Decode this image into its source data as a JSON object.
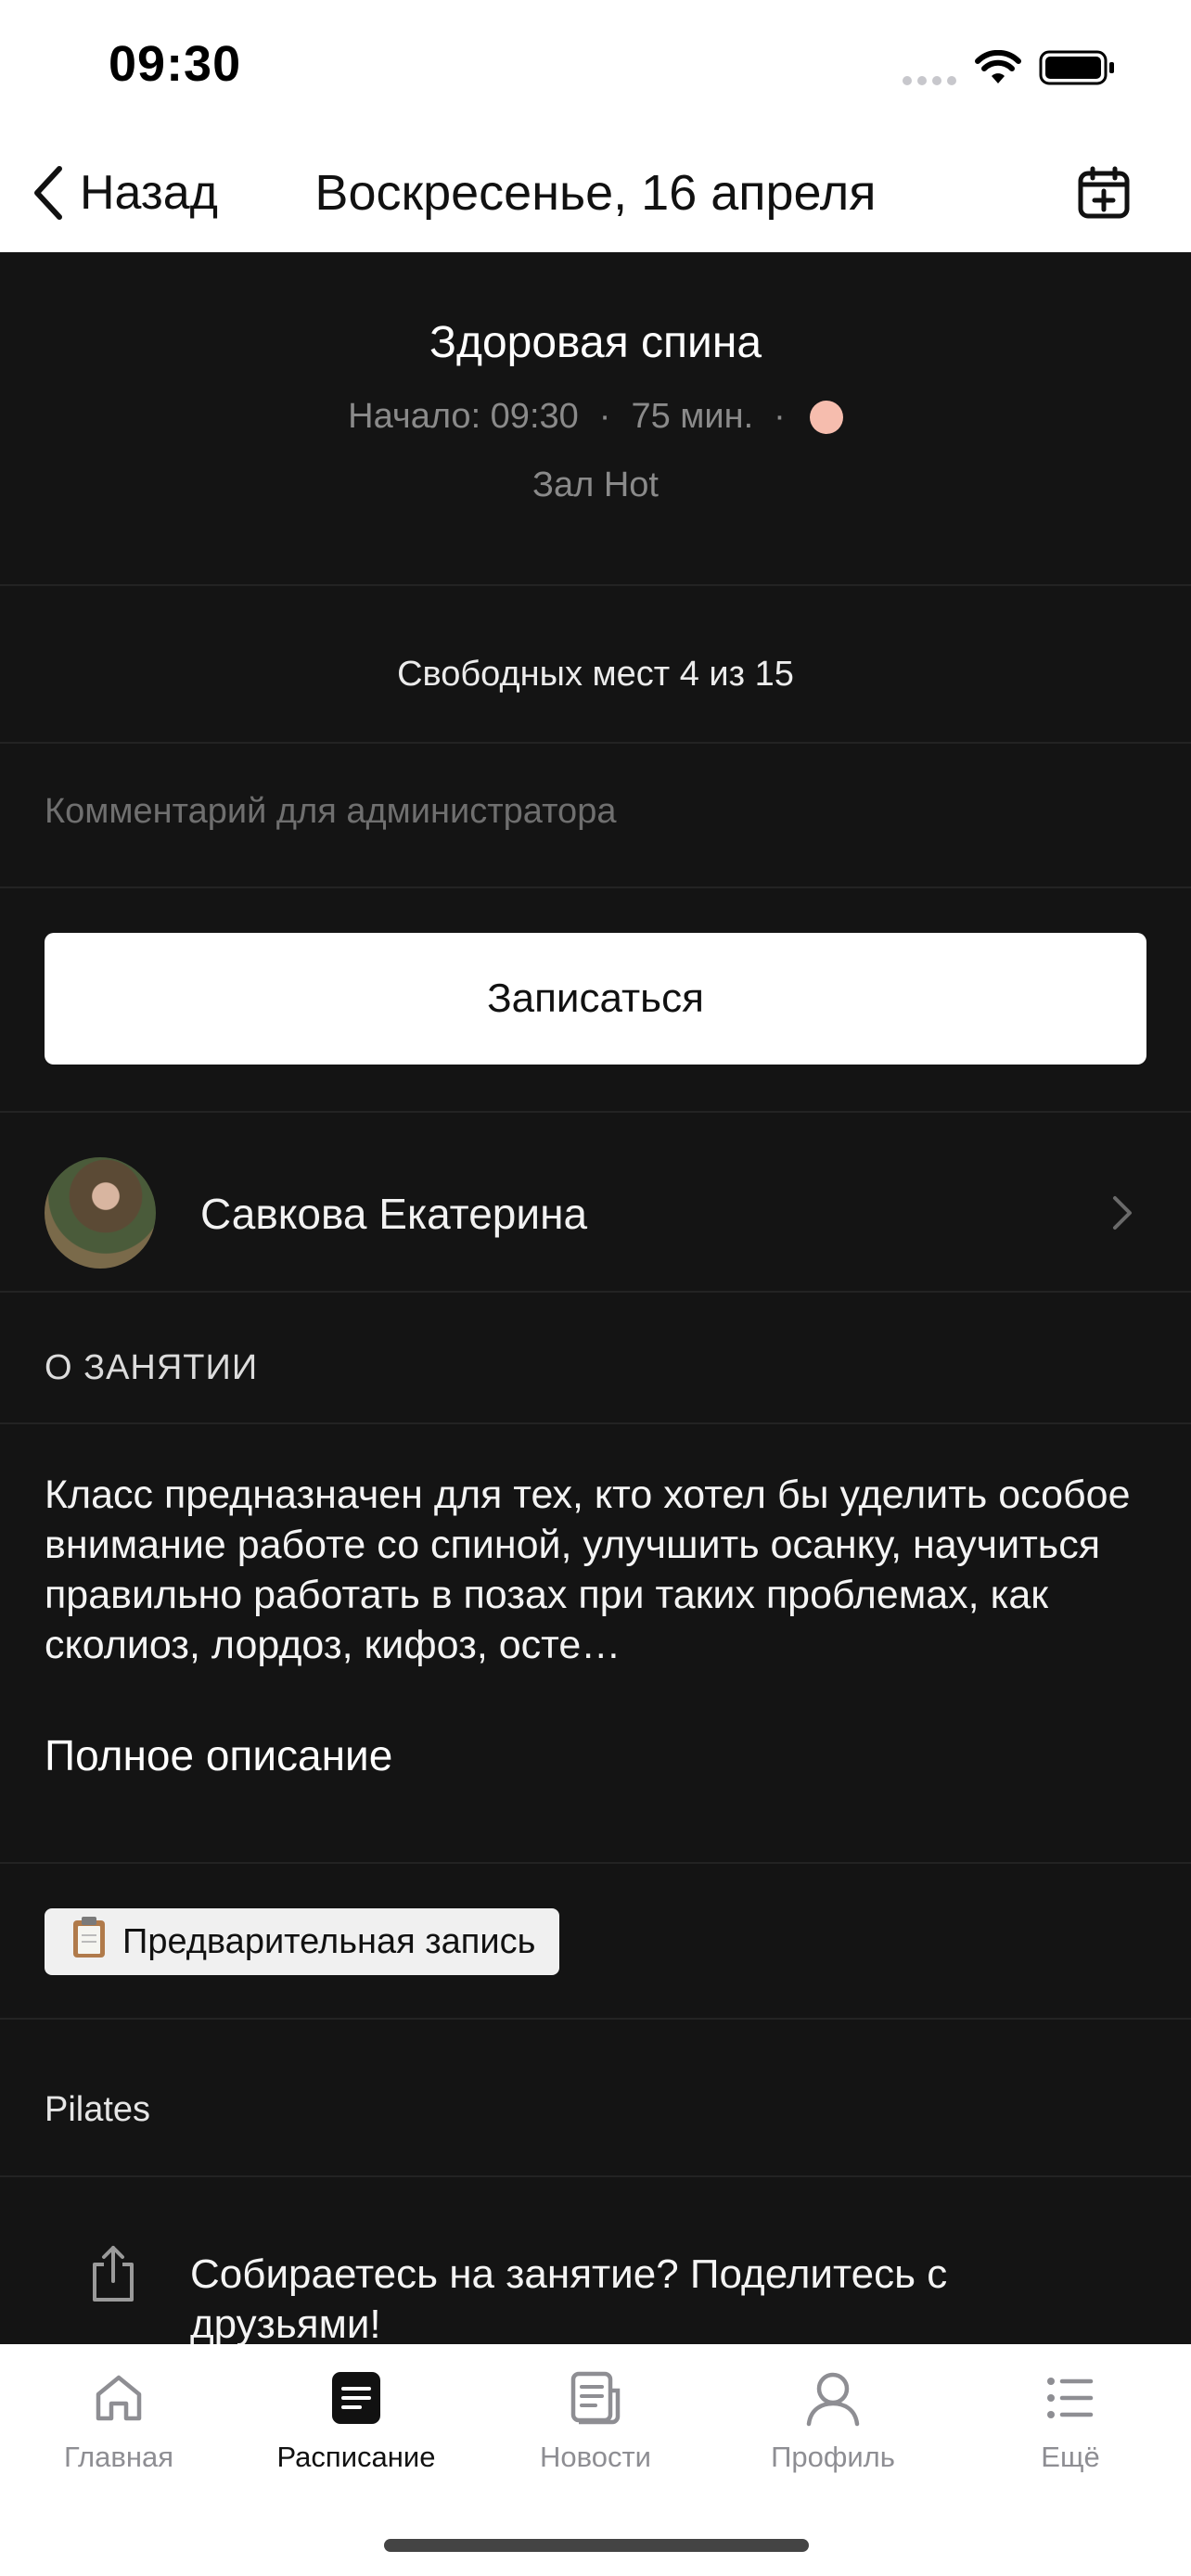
{
  "status_bar": {
    "time": "09:30"
  },
  "nav": {
    "back_label": "Назад",
    "title": "Воскресенье, 16 апреля"
  },
  "class": {
    "title": "Здоровая спина",
    "start": "Начало: 09:30",
    "duration": "75 мин.",
    "hall": "Зал Hot",
    "indicator_color": "#f6bdae"
  },
  "seats": "Свободных мест 4 из 15",
  "comment": {
    "placeholder": "Комментарий для администратора",
    "value": ""
  },
  "signup_label": "Записаться",
  "trainer": {
    "name": "Савкова Екатерина"
  },
  "about": {
    "heading": "О ЗАНЯТИИ",
    "description": "Класс предназначен для тех, кто хотел бы уделить особое внимание работе со спиной, улучшить осанку, научиться правильно работать в позах при таких проблемах, как сколиоз, лордоз, кифоз, осте…",
    "full_link": "Полное описание"
  },
  "badge": {
    "icon": "clipboard-icon",
    "label": "Предварительная запись"
  },
  "tag": "Pilates",
  "share": {
    "text": "Собираетесь на занятие? Поделитесь с друзьями!"
  },
  "tabbar": {
    "active": "schedule",
    "items": [
      {
        "id": "home",
        "label": "Главная",
        "icon": "home-icon"
      },
      {
        "id": "schedule",
        "label": "Расписание",
        "icon": "schedule-icon"
      },
      {
        "id": "news",
        "label": "Новости",
        "icon": "news-icon"
      },
      {
        "id": "profile",
        "label": "Профиль",
        "icon": "profile-icon"
      },
      {
        "id": "more",
        "label": "Ещё",
        "icon": "more-icon"
      }
    ]
  },
  "colors": {
    "background": "#141414",
    "accent_button": "#ffffff"
  }
}
